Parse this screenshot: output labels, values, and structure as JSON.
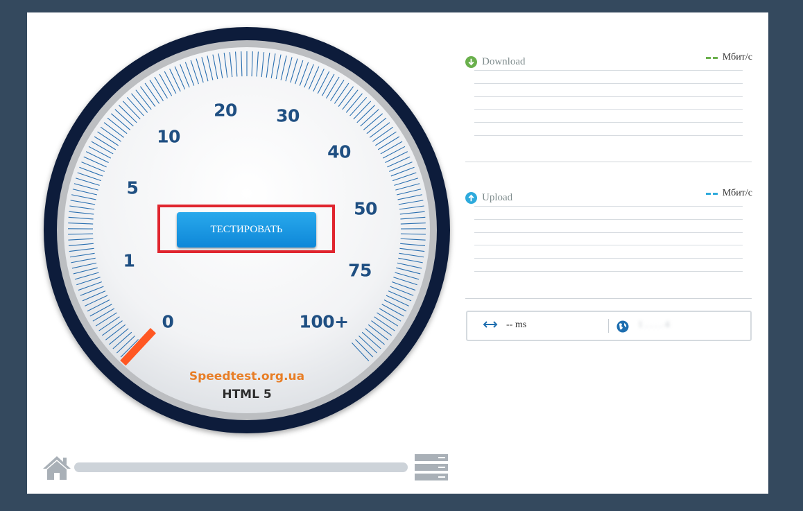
{
  "gauge": {
    "scale": [
      "0",
      "1",
      "5",
      "10",
      "20",
      "30",
      "40",
      "50",
      "75",
      "100+"
    ],
    "brand": "Speedtest.org.ua",
    "engine": "HTML 5",
    "needle_color": "#ff5722",
    "start_label": "ТЕСТИРОВАТЬ"
  },
  "download": {
    "label": "Download",
    "unit": "Мбит/с",
    "accent": "#6ab04c",
    "icon": "arrow-down-circle-icon"
  },
  "upload": {
    "label": "Upload",
    "unit": "Мбит/с",
    "accent": "#2eaadc",
    "icon": "arrow-up-circle-icon"
  },
  "stats": {
    "ping": "-- ms",
    "ip": "1 . . . . 4"
  },
  "progress": {
    "fraction": 0
  },
  "colors": {
    "background": "#34495e",
    "scale_text": "#1f4f82",
    "brand_text": "#e87e26"
  }
}
